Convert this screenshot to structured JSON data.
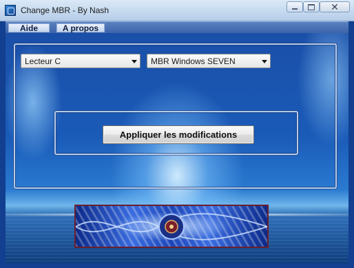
{
  "window": {
    "title": "Change MBR - By Nash",
    "icon": "app-icon",
    "controls": {
      "minimize": "minimize-icon",
      "maximize": "maximize-icon",
      "close": "close-icon"
    },
    "close_glyph": "✕"
  },
  "menu": {
    "items": [
      {
        "label": "Aide"
      },
      {
        "label": "A propos"
      }
    ]
  },
  "form": {
    "drive_select": {
      "value": "Lecteur C"
    },
    "mbr_select": {
      "value": "MBR Windows SEVEN"
    },
    "apply_button": {
      "label": "Appliquer les modifications"
    }
  },
  "colors": {
    "accent": "#123f8f",
    "banner_border": "#6b1f2c"
  }
}
